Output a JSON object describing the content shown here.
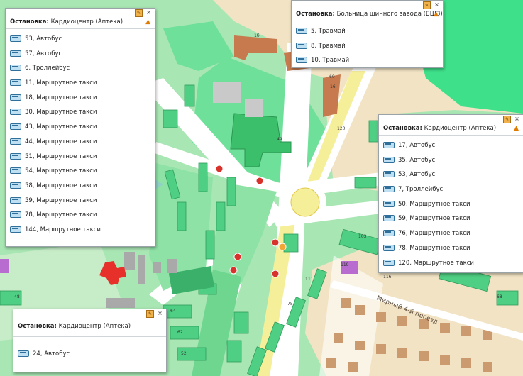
{
  "popups": [
    {
      "stop_label": "Остановка:",
      "stop_name": "Кардиоцентр (Аптека)",
      "routes": [
        {
          "label": "53, Автобус",
          "icon": "bus-icon"
        },
        {
          "label": "57, Автобус",
          "icon": "bus-icon"
        },
        {
          "label": "6, Троллейбус",
          "icon": "trolleybus-icon"
        },
        {
          "label": "11, Маршрутное такси",
          "icon": "minibus-icon"
        },
        {
          "label": "18, Маршрутное такси",
          "icon": "minibus-icon"
        },
        {
          "label": "30, Маршрутное такси",
          "icon": "minibus-icon"
        },
        {
          "label": "43, Маршрутное такси",
          "icon": "minibus-icon"
        },
        {
          "label": "44, Маршрутное такси",
          "icon": "minibus-icon"
        },
        {
          "label": "51, Маршрутное такси",
          "icon": "minibus-icon"
        },
        {
          "label": "54, Маршрутное такси",
          "icon": "minibus-icon"
        },
        {
          "label": "58, Маршрутное такси",
          "icon": "minibus-icon"
        },
        {
          "label": "59, Маршрутное такси",
          "icon": "minibus-icon"
        },
        {
          "label": "78, Маршрутное такси",
          "icon": "minibus-icon"
        },
        {
          "label": "144, Маршрутное такси",
          "icon": "minibus-icon"
        }
      ]
    },
    {
      "stop_label": "Остановка:",
      "stop_name": "Больница шинного завода (БШЗ)",
      "routes": [
        {
          "label": "5, Травмай",
          "icon": "tram-icon"
        },
        {
          "label": "8, Травмай",
          "icon": "tram-icon"
        },
        {
          "label": "10, Травмай",
          "icon": "tram-icon"
        }
      ]
    },
    {
      "stop_label": "Остановка:",
      "stop_name": "Кардиоцентр (Аптека)",
      "routes": [
        {
          "label": "17, Автобус",
          "icon": "bus-icon"
        },
        {
          "label": "35, Автобус",
          "icon": "bus-icon"
        },
        {
          "label": "53, Автобус",
          "icon": "bus-icon"
        },
        {
          "label": "7, Троллейбус",
          "icon": "trolleybus-icon"
        },
        {
          "label": "50, Маршрутное такси",
          "icon": "minibus-icon"
        },
        {
          "label": "59, Маршрутное такси",
          "icon": "minibus-icon"
        },
        {
          "label": "76, Маршрутное такси",
          "icon": "minibus-icon"
        },
        {
          "label": "78, Маршрутное такси",
          "icon": "minibus-icon"
        },
        {
          "label": "120, Маршрутное такси",
          "icon": "minibus-icon"
        }
      ]
    },
    {
      "stop_label": "Остановка:",
      "stop_name": "Кардиоцентр (Аптека)",
      "routes": [
        {
          "label": "24, Автобус",
          "icon": "bus-icon"
        }
      ]
    }
  ],
  "map": {
    "street_name": "Мирный 4-й проезд",
    "house_numbers": [
      "1б",
      "49",
      "60",
      "16",
      "120",
      "103",
      "116",
      "111",
      "75",
      "64",
      "62",
      "52",
      "48",
      "68",
      "119"
    ],
    "colors": {
      "park": "#a8e6b4",
      "residential": "#f2e3c4",
      "building": "#4fcf83",
      "road": "#ffffff",
      "main_road": "#f6ef9a",
      "brick": "#c77a4e",
      "stop_marker": "#d8322c",
      "highlight": "#e8302a"
    },
    "icons": [
      "close-icon",
      "edit-icon",
      "warning-icon",
      "bus-stop-marker-icon",
      "compass-arrow-icon"
    ]
  }
}
